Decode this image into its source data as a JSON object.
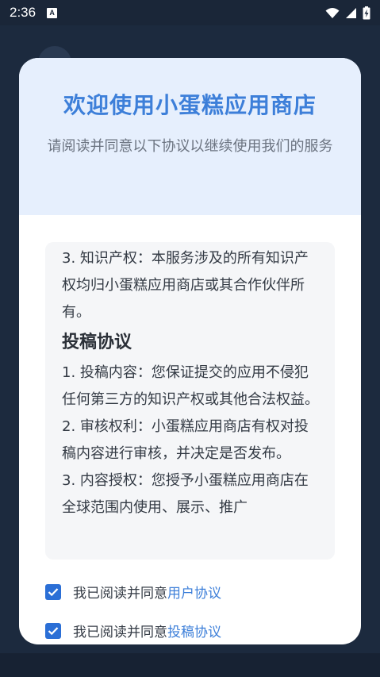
{
  "statusbar": {
    "time": "2:36",
    "notification_icon": "A"
  },
  "dialog": {
    "title": "欢迎使用小蛋糕应用商店",
    "subtitle": "请阅读并同意以下协议以继续使用我们的服务",
    "content": {
      "items": [
        "3. 知识产权：本服务涉及的所有知识产权均归小蛋糕应用商店或其合作伙伴所有。"
      ],
      "heading": "投稿协议",
      "items2": [
        "1. 投稿内容：您保证提交的应用不侵犯任何第三方的知识产权或其他合法权益。",
        "2. 审核权利：小蛋糕应用商店有权对投稿内容进行审核，并决定是否发布。",
        "3. 内容授权：您授予小蛋糕应用商店在全球范围内使用、展示、推广"
      ]
    },
    "agreements": [
      {
        "prefix": "我已阅读并同意",
        "link": "用户协议",
        "checked": true
      },
      {
        "prefix": "我已阅读并同意",
        "link": "投稿协议",
        "checked": true
      }
    ]
  },
  "colors": {
    "accent": "#3d7fd9",
    "checkbox": "#2b6fd6",
    "header_bg": "#e6effd"
  }
}
